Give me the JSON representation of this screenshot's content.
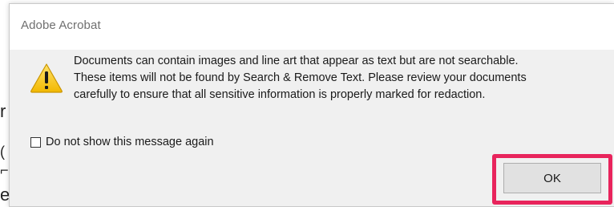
{
  "dialog": {
    "title": "Adobe Acrobat",
    "icon": "warning-icon",
    "message_lines": [
      "Documents can contain images and line art that appear as text but are not searchable.",
      "These items will not be found by Search & Remove Text. Please review your documents",
      "carefully to ensure that all sensitive information is properly marked for redaction."
    ],
    "checkbox_label": "Do not show this message again",
    "checkbox_checked": false,
    "ok_label": "OK"
  },
  "background": {
    "glyphs": [
      "r",
      "(",
      "⌐",
      "e"
    ]
  },
  "colors": {
    "highlight": "#e8245c",
    "warning_fill": "#f5c400",
    "dialog_bg": "#f0f0f0"
  }
}
